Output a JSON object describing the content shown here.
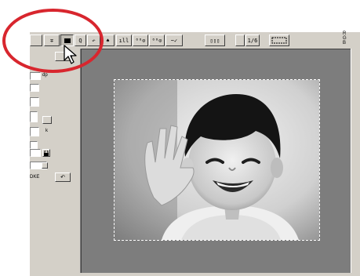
{
  "toolbar": {
    "items": [
      {
        "name": "rotate-tool-button",
        "label": "∓"
      },
      {
        "name": "color-chip-button",
        "label": ""
      },
      {
        "name": "zoom-button",
        "label": "Q"
      },
      {
        "name": "undo-button",
        "label": "↶"
      },
      {
        "name": "brush-button",
        "label": "♠"
      },
      {
        "name": "histogram-button",
        "label": "ıll"
      },
      {
        "name": "curves-button",
        "label": "⁰⁰⊙"
      },
      {
        "name": "levels-button",
        "label": "⁰⁰⊙"
      },
      {
        "name": "variation-button",
        "label": "~✓"
      }
    ],
    "scan_button_label": "▯▯▯",
    "zoom_value": "1/6",
    "channel_label": "R\nG\nB"
  },
  "sidepanel": {
    "box_label": "dp",
    "text_k": "k",
    "text_bottom": "DKE",
    "arrow": "↶"
  },
  "colors": {
    "panel": "#d4d0c8",
    "preview_bg": "#7d7d7d",
    "highlight": "#d8262e"
  }
}
